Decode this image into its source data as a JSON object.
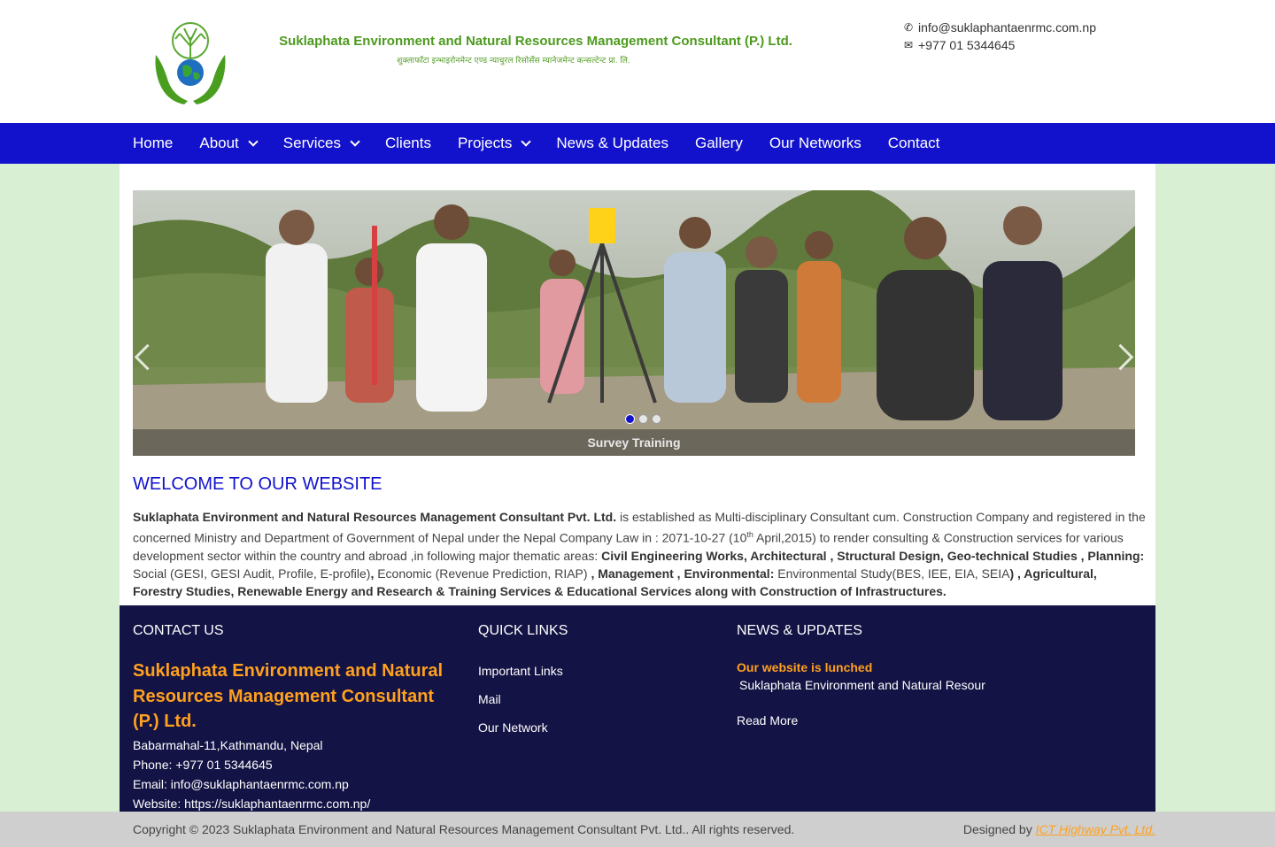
{
  "header": {
    "company_name": "Suklaphata Environment and Natural Resources Management Consultant (P.) Ltd.",
    "company_name_nepali": "शुक्लाफाँटा इन्भाइरोनमेन्ट एण्ड न्याचुरल रिसोर्सेस म्यानेजमेन्ट कन्सल्टेन्ट प्रा. लि.",
    "email": "info@suklaphantaenrmc.com.np",
    "phone": "+977 01 5344645",
    "phone_icon": "phone-icon",
    "email_icon": "envelope-icon"
  },
  "nav": {
    "home": "Home",
    "about": "About",
    "services": "Services",
    "clients": "Clients",
    "projects": "Projects",
    "news": "News & Updates",
    "gallery": "Gallery",
    "networks": "Our Networks",
    "contact": "Contact"
  },
  "slider": {
    "caption": "Survey Training",
    "slide_count": 3,
    "active_slide": 1
  },
  "welcome": {
    "heading": "WELCOME TO OUR WEBSITE",
    "company": "Suklaphata Environment and Natural Resources Management Consultant Pvt. Ltd.",
    "p1": " is established as Multi-disciplinary Consultant cum. Construction Company and registered in the concerned Ministry and Department of Government of Nepal under the Nepal Company Law in : 2071-10-27 (10",
    "sup": "th",
    "p2": " April,2015) to render consulting & Construction services for various development sector within the country and abroad ,in   following  major thematic areas: ",
    "b1": "Civil Engineering Works, Architectural , Structural Design, Geo-technical Studies , Planning:",
    "p3": " Social (GESI, GESI Audit, Profile, E-profile)",
    "b2": ",",
    "p4": " Economic (Revenue Prediction, RIAP) ",
    "b3": ", Management , Environmental:",
    "p5": " Environmental Study(BES, IEE, EIA, SEIA",
    "b4": ") , Agricultural, Forestry Studies, Renewable Energy and Research & Training Services & Educational Services along with Construction of Infrastructures."
  },
  "footer": {
    "contact_heading": "CONTACT US",
    "company": "Suklaphata Environment and Natural Resources Management Consultant (P.) Ltd.",
    "address": "Babarmahal-11,Kathmandu, Nepal",
    "phone": "Phone: +977 01 5344645",
    "email": "Email: info@suklaphantaenrmc.com.np",
    "website": "Website: https://suklaphantaenrmc.com.np/",
    "quick_heading": "QUICK LINKS",
    "links": [
      "Important Links",
      "Mail",
      "Our Network"
    ],
    "news_heading": "NEWS & UPDATES",
    "news_title": "Our website is lunched",
    "news_text": "Suklaphata Environment and Natural Resour",
    "read_more": "Read More"
  },
  "bottom": {
    "copyright": "Copyright © 2023 Suklaphata Environment and Natural Resources Management Consultant Pvt. Ltd.. All rights reserved.",
    "designed_by": "Designed by ",
    "designer": "ICT Highway Pvt. Ltd."
  },
  "colors": {
    "nav_bg": "#1212cc",
    "brand_green": "#4d9a1f",
    "footer_bg": "#131345",
    "accent_orange": "#ffa01e",
    "page_bg": "#d9efd3"
  }
}
